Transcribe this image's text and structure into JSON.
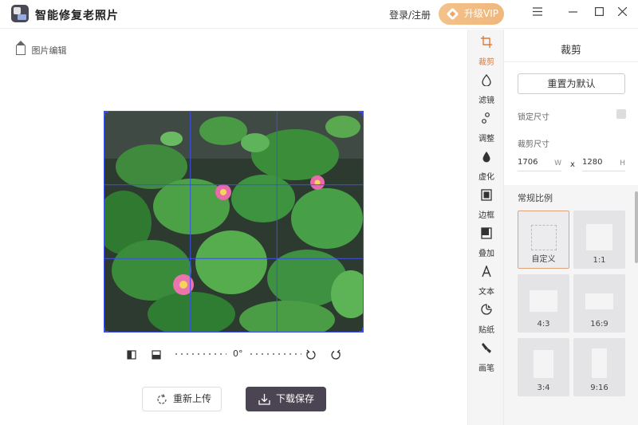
{
  "app": {
    "title": "智能修复老照片"
  },
  "header": {
    "login_label": "登录/注册",
    "vip_label": "升级VIP",
    "menu_icon": "menu-icon",
    "minimize_icon": "minimize-icon",
    "maximize_icon": "maximize-icon",
    "close_icon": "close-icon"
  },
  "breadcrumb": {
    "label": "图片编辑"
  },
  "rotation": {
    "angle": "0°"
  },
  "actions": {
    "reupload_label": "重新上传",
    "download_label": "下载保存"
  },
  "tools": [
    {
      "label": "裁剪",
      "icon": "crop-icon",
      "active": true
    },
    {
      "label": "滤镜",
      "icon": "filter-icon",
      "active": false
    },
    {
      "label": "调整",
      "icon": "adjust-icon",
      "active": false
    },
    {
      "label": "虚化",
      "icon": "blur-icon",
      "active": false
    },
    {
      "label": "边框",
      "icon": "frame-icon",
      "active": false
    },
    {
      "label": "叠加",
      "icon": "overlay-icon",
      "active": false
    },
    {
      "label": "文本",
      "icon": "text-icon",
      "active": false
    },
    {
      "label": "贴纸",
      "icon": "sticker-icon",
      "active": false
    },
    {
      "label": "画笔",
      "icon": "brush-icon",
      "active": false
    }
  ],
  "panel": {
    "title": "裁剪",
    "reset_label": "重置为默认",
    "lock_size_label": "锁定尺寸",
    "crop_size_label": "裁剪尺寸",
    "width_value": "1706",
    "width_unit": "W",
    "height_value": "1280",
    "height_unit": "H",
    "separator": "x",
    "ratio_title": "常规比例",
    "ratios": [
      {
        "label": "自定义",
        "selected": true
      },
      {
        "label": "1:1",
        "selected": false
      },
      {
        "label": "4:3",
        "selected": false
      },
      {
        "label": "16:9",
        "selected": false
      },
      {
        "label": "3:4",
        "selected": false
      },
      {
        "label": "9:16",
        "selected": false
      }
    ]
  },
  "colors": {
    "accent": "#e0793a",
    "vip_gold": "#f0b77c",
    "dark_button": "#4a4453",
    "crop_grid": "#3b4ff0"
  }
}
